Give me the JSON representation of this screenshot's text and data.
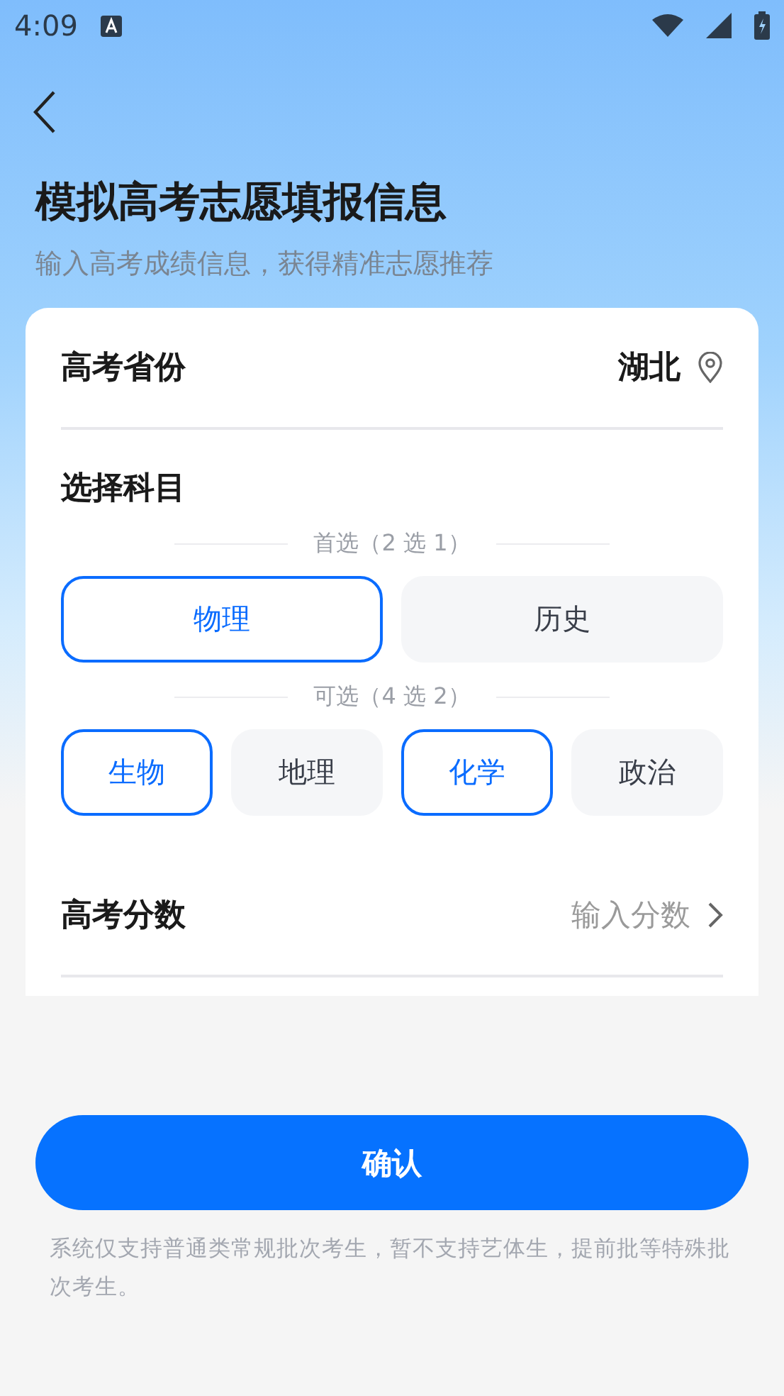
{
  "status_bar": {
    "time": "4:09"
  },
  "header": {
    "title": "模拟高考志愿填报信息",
    "subtitle": "输入高考成绩信息，获得精准志愿推荐"
  },
  "province": {
    "label": "高考省份",
    "value": "湖北"
  },
  "subjects": {
    "label": "选择科目",
    "groups": [
      {
        "label": "首选（2 选 1）",
        "options": [
          {
            "label": "物理",
            "selected": true
          },
          {
            "label": "历史",
            "selected": false
          }
        ]
      },
      {
        "label": "可选（4 选 2）",
        "options": [
          {
            "label": "生物",
            "selected": true
          },
          {
            "label": "地理",
            "selected": false
          },
          {
            "label": "化学",
            "selected": true
          },
          {
            "label": "政治",
            "selected": false
          }
        ]
      }
    ]
  },
  "score": {
    "label": "高考分数",
    "placeholder": "输入分数"
  },
  "confirm_button": "确认",
  "note": "系统仅支持普通类常规批次考生，暂不支持艺体生，提前批等特殊批次考生。"
}
